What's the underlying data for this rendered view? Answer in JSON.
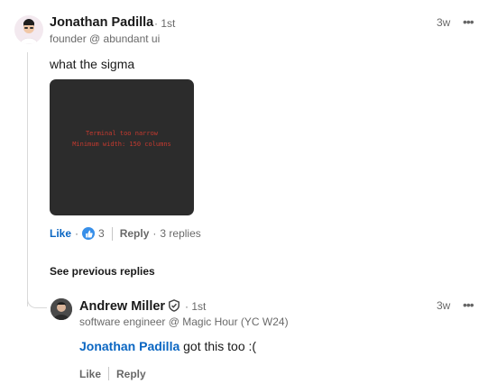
{
  "comment": {
    "author_name": "Jonathan Padilla",
    "degree": "· 1st",
    "headline": "founder @ abundant ui",
    "time": "3w",
    "more": "•••",
    "text": "what the sigma",
    "media": {
      "line1": "Terminal too narrow",
      "line2": "Minimum width: 150 columns"
    },
    "like_label": "Like",
    "reaction_count": "3",
    "reply_label": "Reply",
    "replies_count": "3 replies"
  },
  "see_previous": "See previous replies",
  "reply": {
    "author_name": "Andrew Miller",
    "degree": "· 1st",
    "headline": "software engineer @ Magic Hour (YC W24)",
    "time": "3w",
    "more": "•••",
    "mention": "Jonathan Padilla",
    "text": " got this too :(",
    "like_label": "Like",
    "reply_label": "Reply"
  },
  "colors": {
    "link_blue": "#0a66c2",
    "reaction_blue": "#378fe9",
    "terminal_bg": "#2c2c2c",
    "terminal_text": "#c43a2f"
  },
  "icons": {
    "reaction": "thumbs-up-icon",
    "verified": "verified-shield-icon",
    "more": "more-options-icon"
  }
}
